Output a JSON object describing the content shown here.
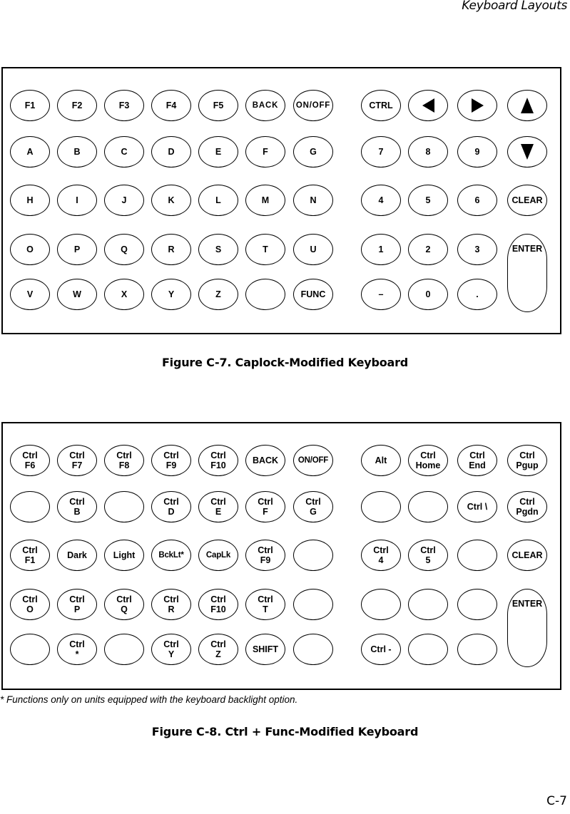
{
  "header": {
    "running_head": "Keyboard Layouts"
  },
  "figure_c7": {
    "caption": "Figure C-7.  Caplock-Modified Keyboard",
    "rows": [
      [
        {
          "label": "F1"
        },
        {
          "label": "F2"
        },
        {
          "label": "F3"
        },
        {
          "label": "F4"
        },
        {
          "label": "F5"
        },
        {
          "label": "BACK",
          "style": "narrow"
        },
        {
          "label": "ON/OFF",
          "style": "narrow"
        },
        {
          "label": "CTRL"
        },
        {
          "label": "",
          "icon": "left-arrow-icon"
        },
        {
          "label": "",
          "icon": "right-arrow-icon"
        },
        {
          "label": "",
          "icon": "up-arrow-icon"
        }
      ],
      [
        {
          "label": "A"
        },
        {
          "label": "B"
        },
        {
          "label": "C"
        },
        {
          "label": "D"
        },
        {
          "label": "E"
        },
        {
          "label": "F"
        },
        {
          "label": "G"
        },
        {
          "label": "7"
        },
        {
          "label": "8"
        },
        {
          "label": "9"
        },
        {
          "label": "",
          "icon": "down-arrow-icon"
        }
      ],
      [
        {
          "label": "H"
        },
        {
          "label": "I"
        },
        {
          "label": "J"
        },
        {
          "label": "K"
        },
        {
          "label": "L"
        },
        {
          "label": "M"
        },
        {
          "label": "N"
        },
        {
          "label": "4"
        },
        {
          "label": "5"
        },
        {
          "label": "6"
        },
        {
          "label": "CLEAR"
        }
      ],
      [
        {
          "label": "O"
        },
        {
          "label": "P"
        },
        {
          "label": "Q"
        },
        {
          "label": "R"
        },
        {
          "label": "S"
        },
        {
          "label": "T"
        },
        {
          "label": "U"
        },
        {
          "label": "1"
        },
        {
          "label": "2"
        },
        {
          "label": "3"
        },
        {
          "label": "ENTER",
          "tall": true
        }
      ],
      [
        {
          "label": "V"
        },
        {
          "label": "W"
        },
        {
          "label": "X"
        },
        {
          "label": "Y"
        },
        {
          "label": "Z"
        },
        {
          "label": ""
        },
        {
          "label": "FUNC"
        },
        {
          "label": "–"
        },
        {
          "label": "0"
        },
        {
          "label": "."
        }
      ]
    ]
  },
  "figure_c8": {
    "caption": "Figure C-8.  Ctrl + Func-Modified Keyboard",
    "footnote": "* Functions only on units equipped with the keyboard backlight option.",
    "rows": [
      [
        {
          "label": "Ctrl\nF6"
        },
        {
          "label": "Ctrl\nF7"
        },
        {
          "label": "Ctrl\nF8"
        },
        {
          "label": "Ctrl\nF9"
        },
        {
          "label": "Ctrl\nF10"
        },
        {
          "label": "BACK"
        },
        {
          "label": "ON/OFF",
          "style": "condensed"
        },
        {
          "label": "Alt"
        },
        {
          "label": "Ctrl\nHome"
        },
        {
          "label": "Ctrl\nEnd"
        },
        {
          "label": "Ctrl\nPgup"
        }
      ],
      [
        {
          "label": ""
        },
        {
          "label": "Ctrl\nB"
        },
        {
          "label": ""
        },
        {
          "label": "Ctrl\nD"
        },
        {
          "label": "Ctrl\nE"
        },
        {
          "label": "Ctrl\nF"
        },
        {
          "label": "Ctrl\nG"
        },
        {
          "label": ""
        },
        {
          "label": ""
        },
        {
          "label": "Ctrl \\"
        },
        {
          "label": "Ctrl\nPgdn"
        }
      ],
      [
        {
          "label": "Ctrl\nF1"
        },
        {
          "label": "Dark"
        },
        {
          "label": "Light"
        },
        {
          "label": "BckLt*",
          "style": "condensed"
        },
        {
          "label": "CapLk",
          "style": "condensed"
        },
        {
          "label": "Ctrl\nF9"
        },
        {
          "label": ""
        },
        {
          "label": "Ctrl\n4"
        },
        {
          "label": "Ctrl\n5"
        },
        {
          "label": ""
        },
        {
          "label": "CLEAR"
        }
      ],
      [
        {
          "label": "Ctrl\nO"
        },
        {
          "label": "Ctrl\nP"
        },
        {
          "label": "Ctrl\nQ"
        },
        {
          "label": "Ctrl\nR"
        },
        {
          "label": "Ctrl\nF10"
        },
        {
          "label": "Ctrl\nT"
        },
        {
          "label": ""
        },
        {
          "label": ""
        },
        {
          "label": ""
        },
        {
          "label": ""
        },
        {
          "label": "ENTER",
          "tall": true
        }
      ],
      [
        {
          "label": ""
        },
        {
          "label": "Ctrl\n*"
        },
        {
          "label": ""
        },
        {
          "label": "Ctrl\nY"
        },
        {
          "label": "Ctrl\nZ"
        },
        {
          "label": "SHIFT"
        },
        {
          "label": ""
        },
        {
          "label": "Ctrl -"
        },
        {
          "label": ""
        },
        {
          "label": ""
        }
      ]
    ]
  },
  "footer": {
    "page_number": "C-7"
  }
}
